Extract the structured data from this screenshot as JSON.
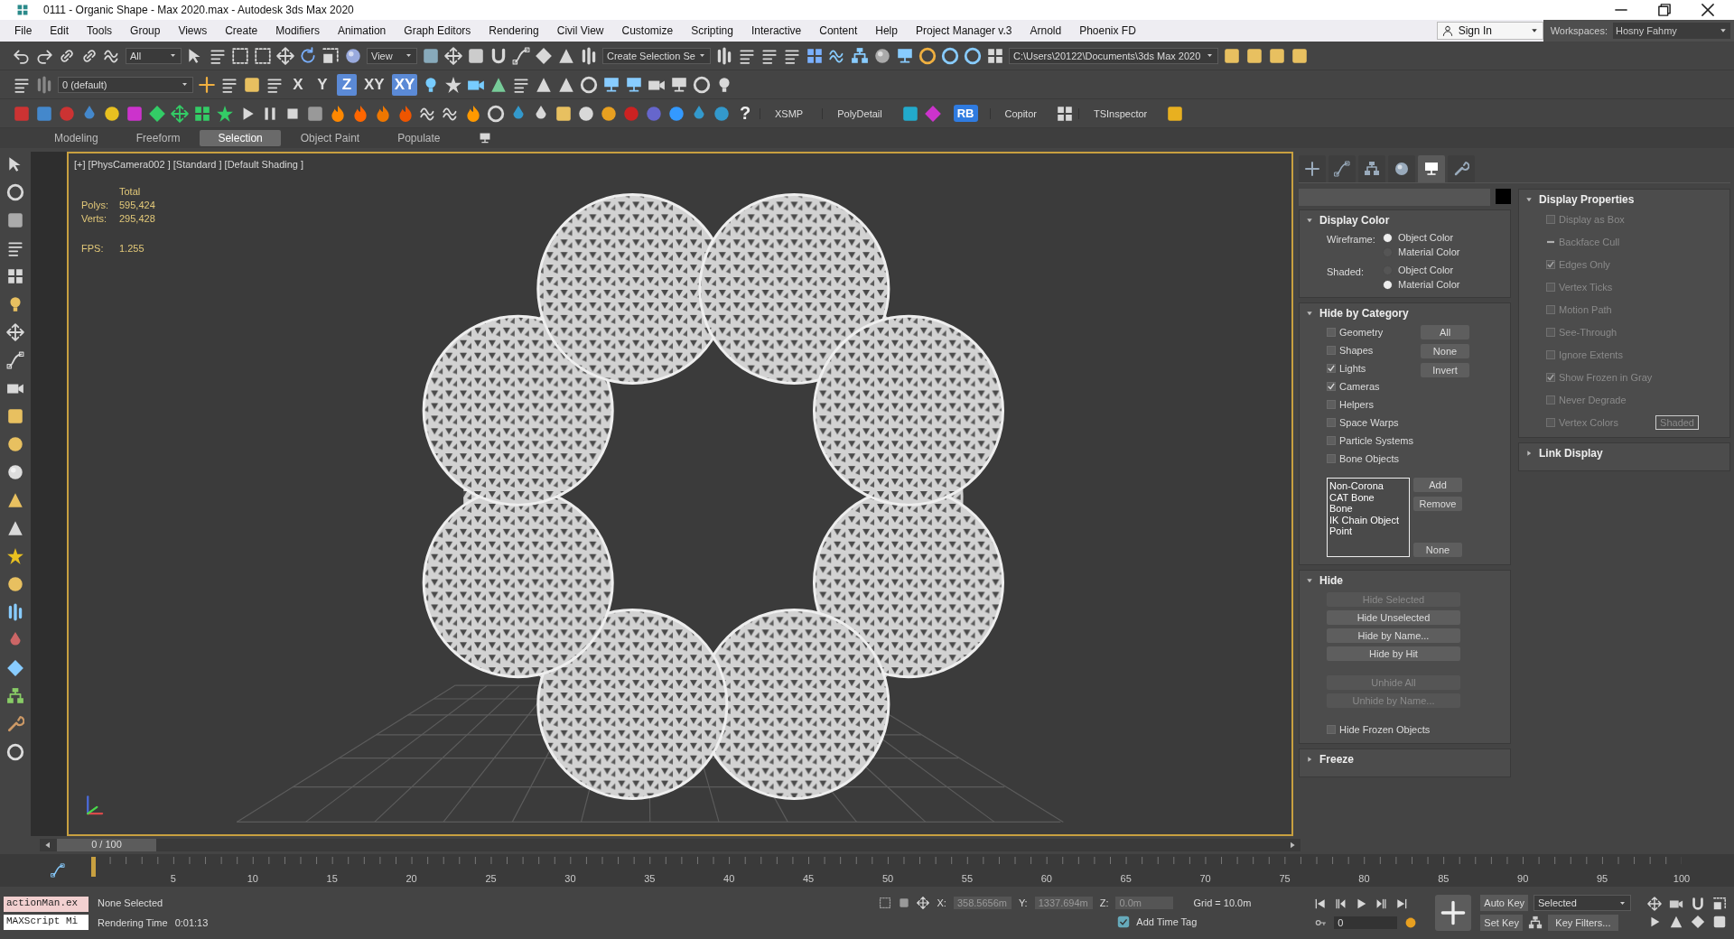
{
  "title_bar": {
    "title": "0111 - Organic Shape - Max 2020.max - Autodesk 3ds Max 2020"
  },
  "menu_bar": {
    "items": [
      "File",
      "Edit",
      "Tools",
      "Group",
      "Views",
      "Create",
      "Modifiers",
      "Animation",
      "Graph Editors",
      "Rendering",
      "Civil View",
      "Customize",
      "Scripting",
      "Interactive",
      "Content",
      "Help",
      "Project Manager v.3",
      "Arnold",
      "Phoenix FD"
    ],
    "sign_in": "Sign In",
    "workspaces_label": "Workspaces:",
    "workspace": "Hosny Fahmy"
  },
  "main_toolbar": {
    "selection_filter": "All",
    "reference_coordinate": "View",
    "named_selection": "Create Selection Se",
    "project_path": "C:\\Users\\20122\\Documents\\3ds Max 2020"
  },
  "layer_toolbar": {
    "layer": "0 (default)",
    "axis_buttons": [
      {
        "label": "X",
        "selected": false
      },
      {
        "label": "Y",
        "selected": false
      },
      {
        "label": "Z",
        "selected": true
      },
      {
        "label": "XY",
        "selected": false
      },
      {
        "label": "XY",
        "selected": true
      }
    ]
  },
  "plugin_toolbar": {
    "items": [
      {
        "label": "?",
        "kind": "help"
      },
      {
        "label": "XSMP",
        "kind": "text"
      },
      {
        "label": "PolyDetail",
        "kind": "text"
      },
      {
        "label": "RB",
        "kind": "badge"
      },
      {
        "label": "Copitor",
        "kind": "text"
      },
      {
        "label": "TSInspector",
        "kind": "text"
      }
    ]
  },
  "ribbon_tabs": [
    {
      "label": "Modeling",
      "selected": false
    },
    {
      "label": "Freeform",
      "selected": false
    },
    {
      "label": "Selection",
      "selected": true
    },
    {
      "label": "Object Paint",
      "selected": false
    },
    {
      "label": "Populate",
      "selected": false
    }
  ],
  "viewport": {
    "label": "[+] [PhysCamera002 ] [Standard ] [Default Shading ]",
    "stats_header": "Total",
    "stats": [
      {
        "label": "Polys:",
        "value": "595,424"
      },
      {
        "label": "Verts:",
        "value": "295,428"
      }
    ],
    "fps": {
      "label": "FPS:",
      "value": "1.255"
    }
  },
  "command_panel": {
    "tabs": [
      {
        "kind": "create",
        "selected": false
      },
      {
        "kind": "modify",
        "selected": false
      },
      {
        "kind": "hierarchy",
        "selected": false
      },
      {
        "kind": "motion",
        "selected": false
      },
      {
        "kind": "display",
        "selected": true
      },
      {
        "kind": "utilities",
        "selected": false
      }
    ],
    "left_rollouts": [
      {
        "kind": "radio_groups",
        "title": "Display Color",
        "expanded": true,
        "groups": [
          {
            "label": "Wireframe:",
            "options": [
              {
                "label": "Object Color",
                "selected": true
              },
              {
                "label": "Material Color",
                "selected": false
              }
            ]
          },
          {
            "label": "Shaded:",
            "options": [
              {
                "label": "Object Color",
                "selected": false
              },
              {
                "label": "Material Color",
                "selected": true
              }
            ]
          }
        ]
      },
      {
        "kind": "category",
        "title": "Hide by Category",
        "expanded": true,
        "checkboxes": [
          {
            "label": "Geometry",
            "checked": false
          },
          {
            "label": "Shapes",
            "checked": false
          },
          {
            "label": "Lights",
            "checked": true
          },
          {
            "label": "Cameras",
            "checked": true
          },
          {
            "label": "Helpers",
            "checked": false
          },
          {
            "label": "Space Warps",
            "checked": false
          },
          {
            "label": "Particle Systems",
            "checked": false
          },
          {
            "label": "Bone Objects",
            "checked": false
          }
        ],
        "buttons": [
          "All",
          "None",
          "Invert"
        ],
        "list": [
          "Non-Corona",
          "CAT Bone",
          "Bone",
          "IK Chain Object",
          "Point"
        ],
        "list_buttons": [
          "Add",
          "Remove",
          "None"
        ]
      },
      {
        "kind": "buttons",
        "title": "Hide",
        "expanded": true,
        "button_groups": [
          [
            {
              "label": "Hide Selected",
              "disabled": true
            },
            {
              "label": "Hide Unselected",
              "disabled": false
            },
            {
              "label": "Hide by Name...",
              "disabled": false
            },
            {
              "label": "Hide by Hit",
              "disabled": false
            }
          ],
          [
            {
              "label": "Unhide All",
              "disabled": true
            },
            {
              "label": "Unhide by Name...",
              "disabled": true
            }
          ]
        ],
        "checkboxes": [
          {
            "label": "Hide Frozen Objects",
            "checked": false
          }
        ]
      },
      {
        "kind": "buttons",
        "title": "Freeze",
        "expanded": false
      }
    ],
    "right_rollouts": [
      {
        "kind": "checklist",
        "title": "Display Properties",
        "expanded": true,
        "checkboxes": [
          {
            "label": "Display as Box",
            "checked": false,
            "indeterminate": false,
            "disabled": true
          },
          {
            "label": "Backface Cull",
            "indeterminate": true,
            "disabled": true
          },
          {
            "label": "Edges Only",
            "checked": true,
            "indeterminate": false,
            "disabled": true
          },
          {
            "label": "Vertex Ticks",
            "checked": false,
            "indeterminate": false,
            "disabled": true
          },
          {
            "label": "Motion Path",
            "checked": false,
            "indeterminate": false,
            "disabled": true
          },
          {
            "label": "See-Through",
            "checked": false,
            "indeterminate": false,
            "disabled": true
          },
          {
            "label": "Ignore Extents",
            "checked": false,
            "indeterminate": false,
            "disabled": true
          },
          {
            "label": "Show Frozen in Gray",
            "checked": true,
            "indeterminate": false,
            "disabled": true
          },
          {
            "label": "Never Degrade",
            "checked": false,
            "indeterminate": false,
            "disabled": true
          },
          {
            "label": "Vertex Colors",
            "checked": false,
            "indeterminate": false,
            "disabled": true,
            "side_button": "Shaded"
          }
        ]
      },
      {
        "kind": "checklist",
        "title": "Link Display",
        "expanded": false
      }
    ]
  },
  "time_slider": {
    "label": "0 / 100",
    "level": 0
  },
  "track_bar": {
    "ticks": [
      "5",
      "10",
      "15",
      "20",
      "25",
      "30",
      "35",
      "40",
      "45",
      "50",
      "55",
      "60",
      "65",
      "70",
      "75",
      "80",
      "85",
      "90",
      "95",
      "100"
    ]
  },
  "status_bar": {
    "script_listener": [
      "actionMan.ex",
      "MAXScript Mi"
    ],
    "selection": "None Selected",
    "render_time_label": "Rendering Time",
    "render_time": "0:01:13",
    "coords": [
      {
        "label": "X:",
        "value": "358.5656m"
      },
      {
        "label": "Y:",
        "value": "1337.694m"
      },
      {
        "label": "Z:",
        "value": "0.0m"
      }
    ],
    "grid": "Grid = 10.0m",
    "add_time_tag": "Add Time Tag",
    "frame": "0",
    "auto_key": "Auto Key",
    "key_mode": "Selected",
    "set_key": "Set Key",
    "key_filters": "Key Filters..."
  }
}
